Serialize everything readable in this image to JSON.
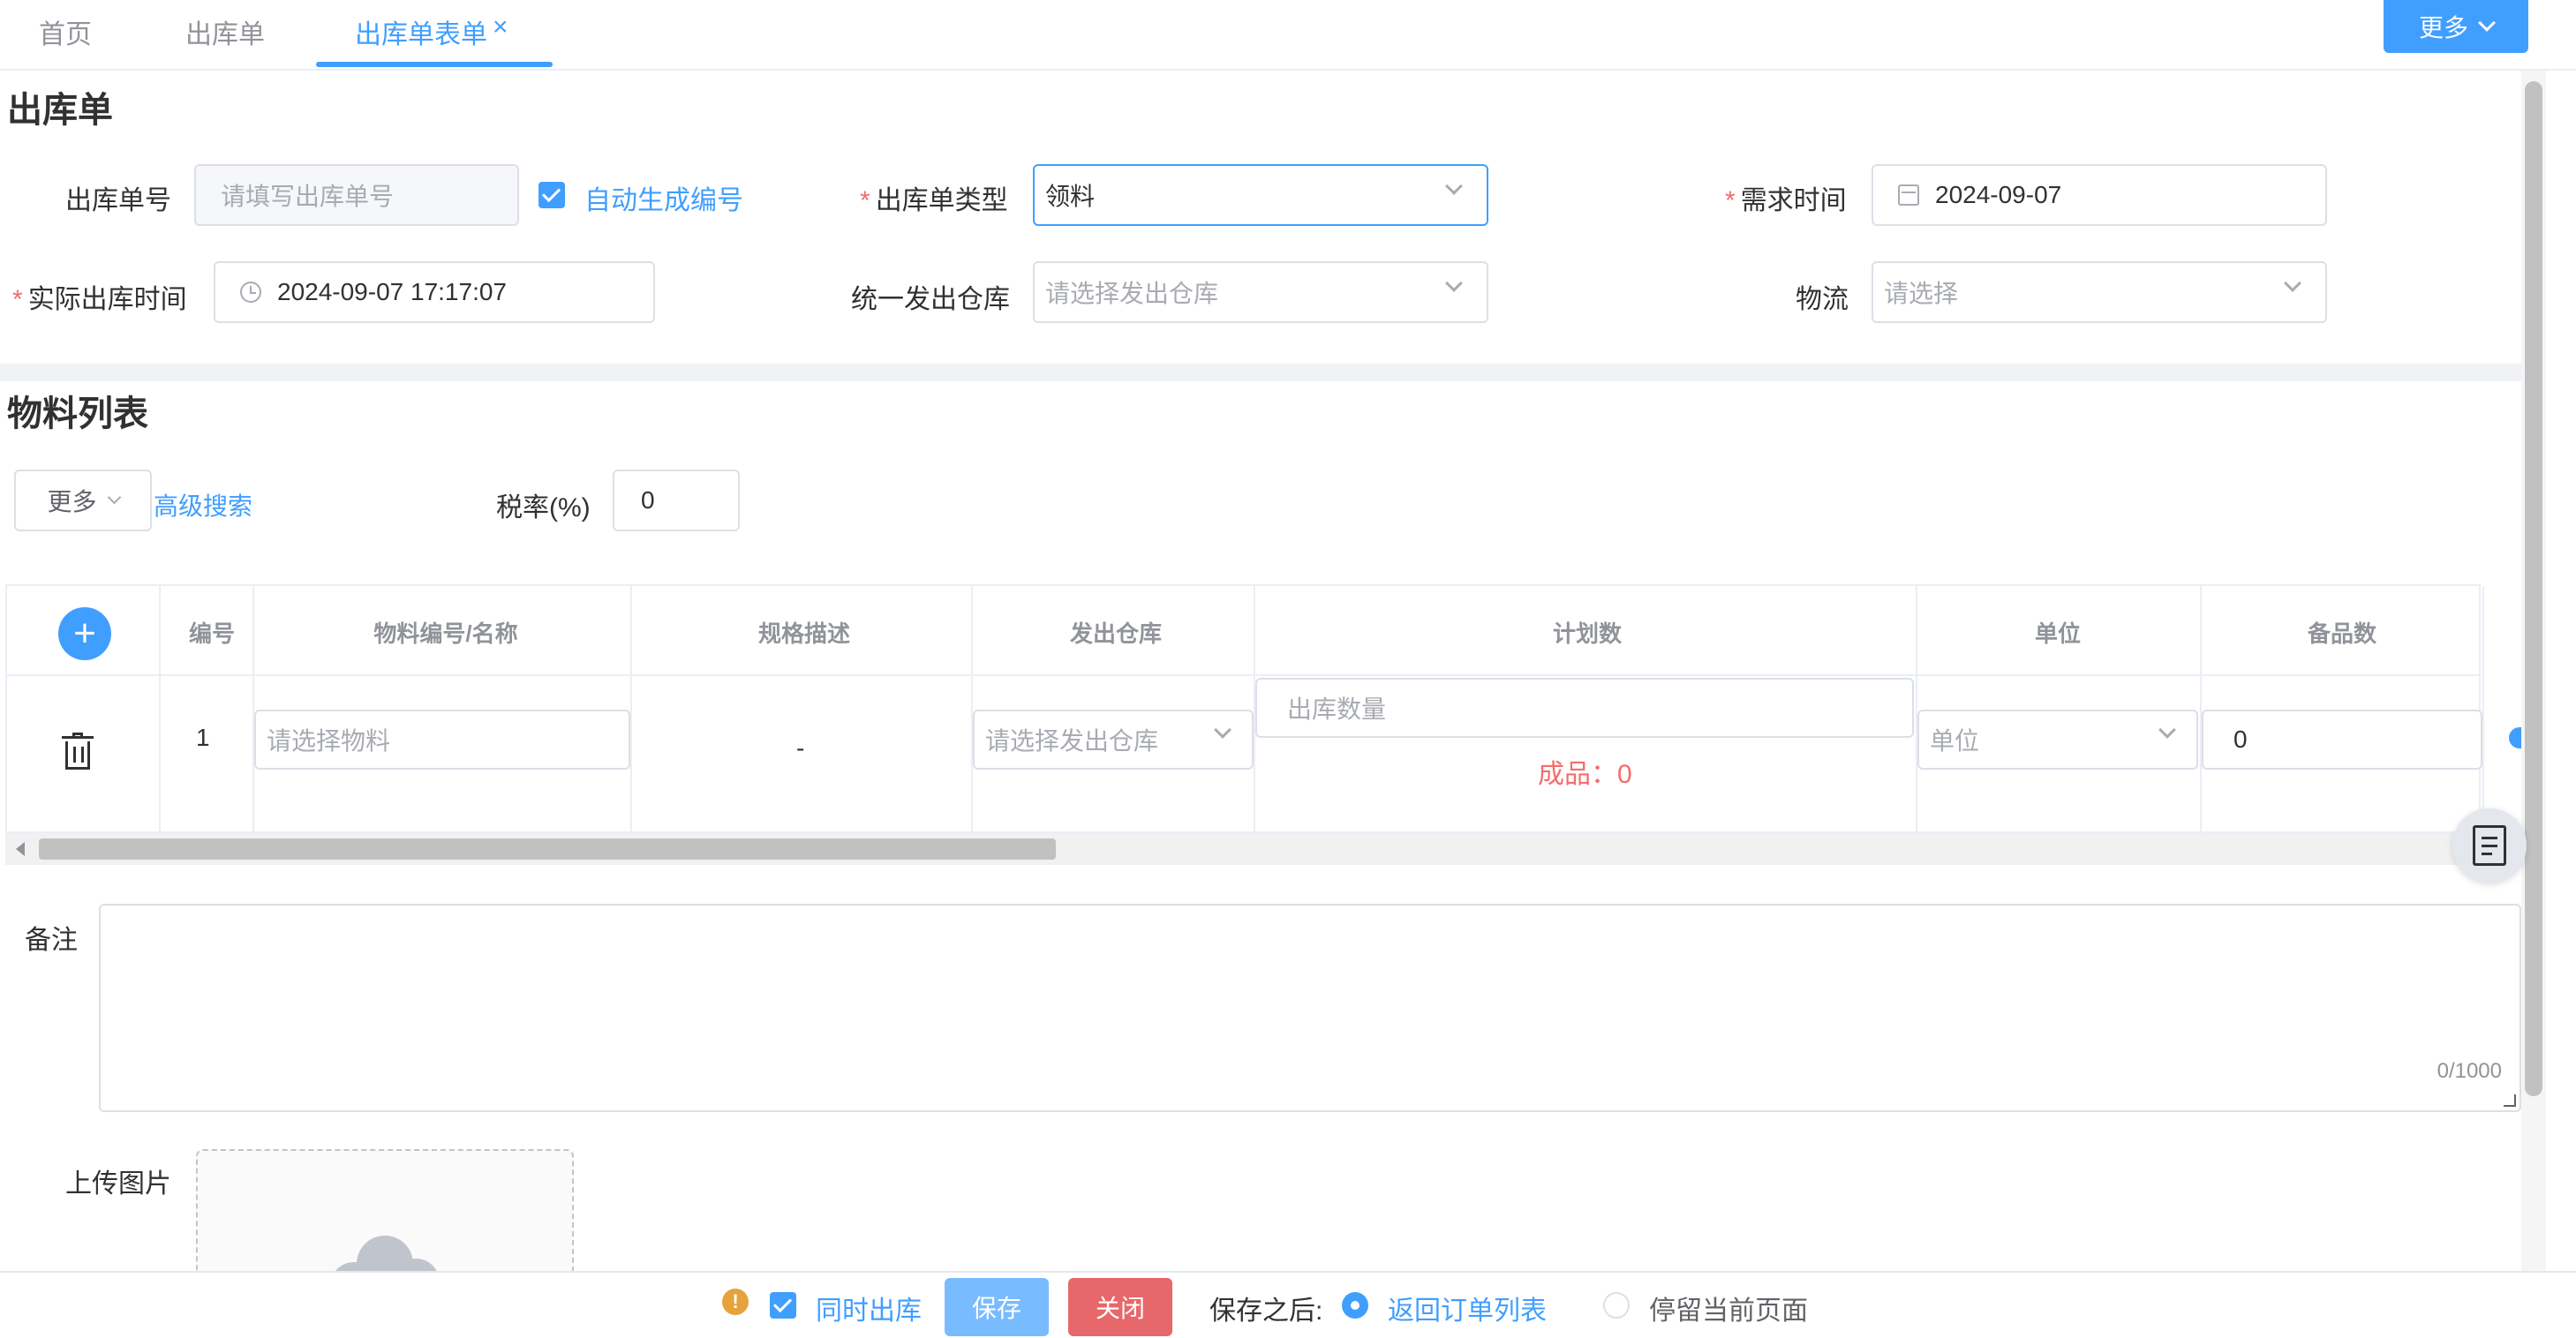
{
  "tabs": [
    {
      "label": "首页"
    },
    {
      "label": "出库单"
    },
    {
      "label": "出库单表单",
      "active": true
    }
  ],
  "top_more_label": "更多",
  "form": {
    "title": "出库单",
    "order_no": {
      "label": "出库单号",
      "placeholder": "请填写出库单号"
    },
    "auto_generate_label": "自动生成编号",
    "order_type": {
      "label": "出库单类型",
      "value": "领料"
    },
    "demand_time": {
      "label": "需求时间",
      "value": "2024-09-07"
    },
    "actual_time": {
      "label": "实际出库时间",
      "value": "2024-09-07 17:17:07"
    },
    "warehouse": {
      "label": "统一发出仓库",
      "placeholder": "请选择发出仓库"
    },
    "logistics": {
      "label": "物流",
      "placeholder": "请选择"
    }
  },
  "materials": {
    "title": "物料列表",
    "more_label": "更多",
    "advanced_search": "高级搜索",
    "tax_label": "税率(%)",
    "tax_value": "0",
    "columns": [
      "编号",
      "物料编号/名称",
      "规格描述",
      "发出仓库",
      "计划数",
      "单位",
      "备品数"
    ],
    "rows": [
      {
        "no": "1",
        "material_placeholder": "请选择物料",
        "spec": "-",
        "warehouse_placeholder": "请选择发出仓库",
        "qty_placeholder": "出库数量",
        "finished_text": "成品：0",
        "unit_placeholder": "单位",
        "spare_value": "0"
      }
    ]
  },
  "remarks": {
    "label": "备注",
    "counter": "0/1000"
  },
  "upload": {
    "label": "上传图片"
  },
  "footer": {
    "simultaneous_label": "同时出库",
    "save_label": "保存",
    "close_label": "关闭",
    "after_save_label": "保存之后:",
    "return_list_label": "返回订单列表",
    "stay_label": "停留当前页面"
  },
  "colors": {
    "primary": "#409eff",
    "danger": "#f56c6c",
    "warning": "#e6a23c"
  }
}
